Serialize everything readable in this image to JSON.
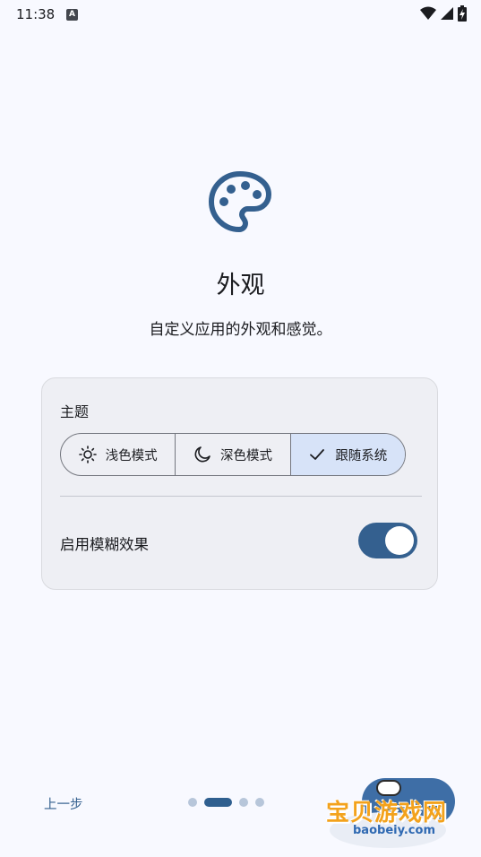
{
  "status_bar": {
    "time": "11:38",
    "notification_icon": "a-icon",
    "icons": [
      "wifi-icon",
      "signal-icon",
      "battery-icon"
    ]
  },
  "header": {
    "icon": "palette-icon",
    "title": "外观",
    "subtitle": "自定义应用的外观和感觉。"
  },
  "theme_card": {
    "label": "主题",
    "options": [
      {
        "label": "浅色模式",
        "icon": "sun-icon",
        "selected": false
      },
      {
        "label": "深色模式",
        "icon": "moon-icon",
        "selected": false
      },
      {
        "label": "跟随系统",
        "icon": "check-icon",
        "selected": true
      }
    ],
    "blur_label": "启用模糊效果",
    "blur_enabled": true
  },
  "footer": {
    "back_label": "上一步",
    "pages_total": 4,
    "page_current": 2
  },
  "watermark": {
    "text": "宝贝游戏网",
    "sub": "baobeiy.com"
  },
  "colors": {
    "accent": "#34608f",
    "background": "#f8f9ff",
    "card": "#eeeff4",
    "selected_segment": "#d7e3f8"
  }
}
